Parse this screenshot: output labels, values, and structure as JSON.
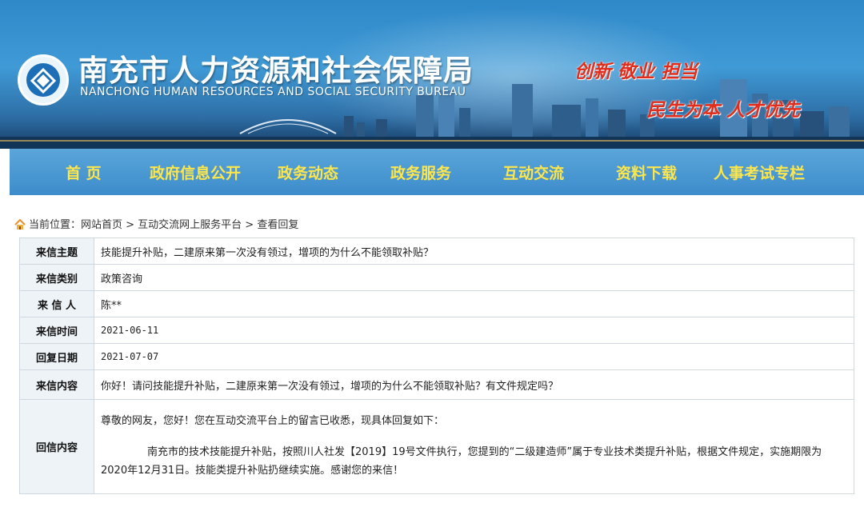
{
  "header": {
    "org_name_cn": "南充市人力资源和社会保障局",
    "org_name_en": "NANCHONG HUMAN RESOURCES AND SOCIAL SECURITY BUREAU",
    "slogan_1": "创新  敬业  担当",
    "slogan_2": "民生为本  人才优先",
    "accent_color": "#e22c1c"
  },
  "nav": {
    "items": [
      "首 页",
      "政府信息公开",
      "政务动态",
      "政务服务",
      "互动交流",
      "资料下载",
      "人事考试专栏"
    ],
    "text_color": "#ffe64a"
  },
  "breadcrumb": {
    "prefix": "当前位置：",
    "path": "网站首页 > 互动交流网上服务平台 > 查看回复"
  },
  "letter": {
    "subject_label": "来信主题",
    "subject": "技能提升补贴，二建原来第一次没有领过，增项的为什么不能领取补贴？",
    "category_label": "来信类别",
    "category": "政策咨询",
    "sender_label": "来 信 人",
    "sender": "陈**",
    "date_label": "来信时间",
    "date": "2021-06-11",
    "reply_date_label": "回复日期",
    "reply_date": "2021-07-07",
    "content_label": "来信内容",
    "content": "你好！请问技能提升补贴，二建原来第一次没有领过，增项的为什么不能领取补贴？有文件规定吗？",
    "reply_label": "回信内容",
    "reply_greeting": "尊敬的网友，您好！您在互动交流平台上的留言已收悉，现具体回复如下：",
    "reply_body": "南充市的技术技能提升补贴，按照川人社发【2019】19号文件执行，您提到的“二级建造师”属于专业技术类提升补贴，根据文件规定，实施期限为2020年12月31日。技能类提升补贴扔继续实施。感谢您的来信！"
  }
}
